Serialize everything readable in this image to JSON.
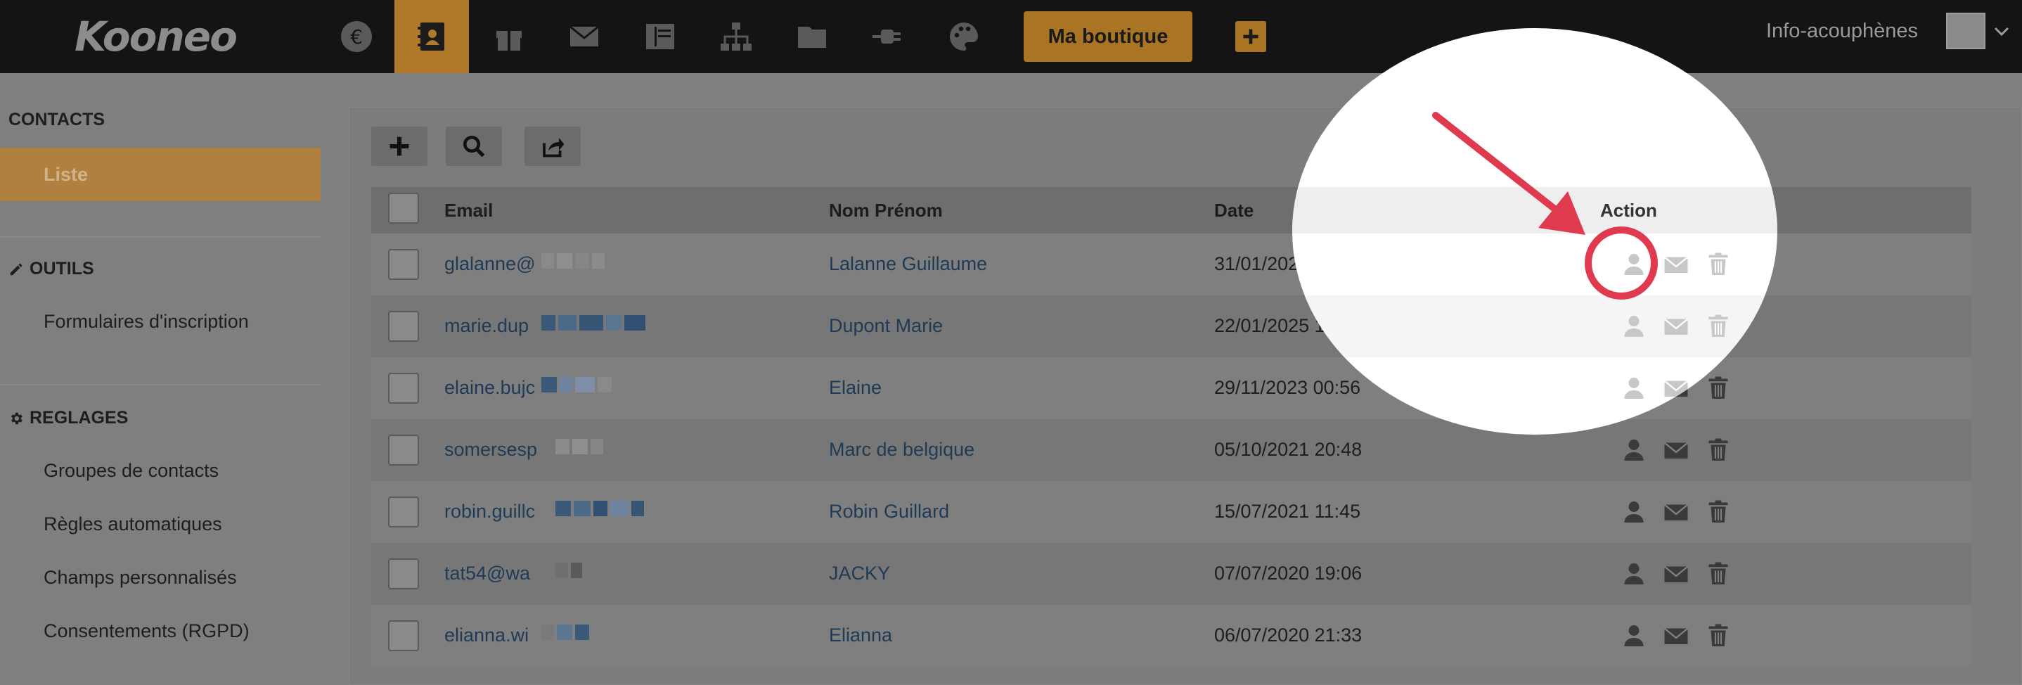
{
  "app": {
    "logo": "Kooneo",
    "shop_button": "Ma boutique",
    "account_name": "Info-acouphènes"
  },
  "nav_icons": [
    "euro-icon",
    "contacts-book-icon",
    "gift-icon",
    "envelope-icon",
    "columns-icon",
    "sitemap-icon",
    "folder-icon",
    "plug-icon",
    "palette-icon"
  ],
  "sidebar": {
    "contacts_heading": "CONTACTS",
    "active_item": "Liste",
    "tools_heading": "OUTILS",
    "tools_items": [
      "Formulaires d'inscription"
    ],
    "settings_heading": "REGLAGES",
    "settings_items": [
      "Groupes de contacts",
      "Règles automatiques",
      "Champs personnalisés",
      "Consentements (RGPD)"
    ]
  },
  "toolbar": {
    "add": "add-icon",
    "search": "search-icon",
    "export": "share-icon"
  },
  "table": {
    "columns": [
      "Email",
      "Nom Prénom",
      "Date",
      "Action"
    ],
    "rows": [
      {
        "email": "glalanne@",
        "name": "Lalanne Guillaume",
        "date": "31/01/2025 13:04"
      },
      {
        "email": "marie.dup",
        "name": "Dupont Marie",
        "date": "22/01/2025 17:06"
      },
      {
        "email": "elaine.bujc",
        "name": "Elaine",
        "date": "29/11/2023 00:56"
      },
      {
        "email": "somersesp",
        "name": "Marc de belgique",
        "date": "05/10/2021 20:48"
      },
      {
        "email": "robin.guillc",
        "name": "Robin Guillard",
        "date": "15/07/2021 11:45"
      },
      {
        "email": "tat54@wa",
        "name": "JACKY",
        "date": "07/07/2020 19:06"
      },
      {
        "email": "elianna.wi",
        "name": "Elianna",
        "date": "06/07/2020 21:33"
      }
    ],
    "row_actions": [
      "user-icon",
      "envelope-icon",
      "trash-icon"
    ]
  },
  "colors": {
    "accent": "#b08040",
    "highlight_ring": "#e03a4e",
    "link": "#1f3a55"
  }
}
